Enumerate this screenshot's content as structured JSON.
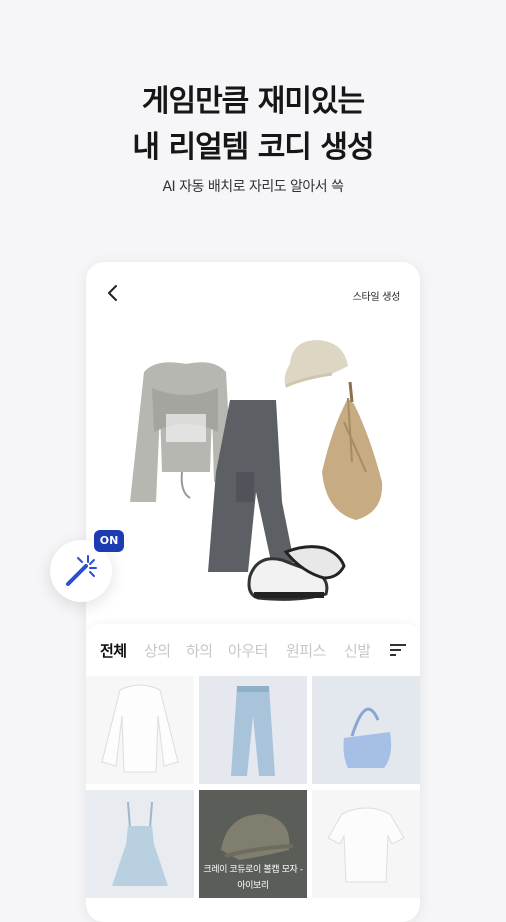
{
  "headline": {
    "line1": "게임만큼 재미있는",
    "line2": "내 리얼템 코디 생성",
    "subtitle": "AI 자동 배치로 자리도 알아서 쓱"
  },
  "card": {
    "header_title": "스타일 생성",
    "tabs": [
      "전체",
      "상의",
      "하의",
      "아우터",
      "원피스",
      "신발"
    ],
    "active_tab": "전체",
    "grid_items": [
      {
        "name": "white-blouse"
      },
      {
        "name": "light-jeans"
      },
      {
        "name": "blue-shoulder-bag"
      },
      {
        "name": "blue-mini-dress"
      },
      {
        "name": "khaki-cap",
        "caption_line1": "크레이 코듀로이 볼캡 모자 -",
        "caption_line2": "아이보리"
      },
      {
        "name": "white-crop-top"
      }
    ]
  },
  "magic_toggle": {
    "badge": "ON"
  },
  "colors": {
    "accent": "#1d3bb3",
    "icon_blue": "#2a4fd6"
  }
}
